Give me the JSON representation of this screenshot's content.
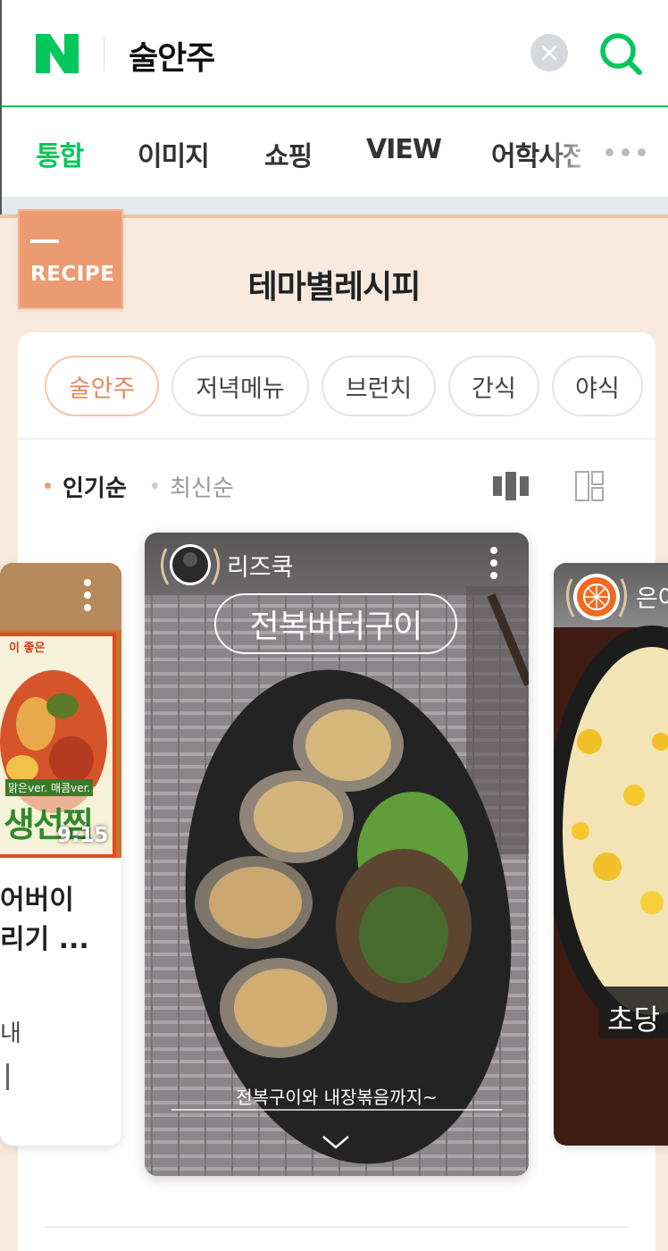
{
  "header": {
    "logo_letter": "N",
    "query": "술안주",
    "clear_icon": "close-icon",
    "search_icon": "search-icon",
    "accent": "#03c75a"
  },
  "tabs": [
    {
      "label": "통합",
      "active": true
    },
    {
      "label": "이미지",
      "active": false
    },
    {
      "label": "쇼핑",
      "active": false
    },
    {
      "label": "VIEW",
      "active": false
    },
    {
      "label": "어학사전",
      "active": false
    }
  ],
  "recipe": {
    "badge": "RECIPE",
    "title": "테마별레시피",
    "badge_color": "#ec9a71",
    "chips": [
      {
        "label": "술안주",
        "active": true
      },
      {
        "label": "저녁메뉴",
        "active": false
      },
      {
        "label": "브런치",
        "active": false
      },
      {
        "label": "간식",
        "active": false
      },
      {
        "label": "야식",
        "active": false
      }
    ],
    "sort": {
      "popular": "인기순",
      "latest": "최신순",
      "active": "popular"
    },
    "view_icons": [
      "column-view-icon",
      "grid-view-icon"
    ]
  },
  "cards": {
    "left": {
      "overlay_top": "이 좋은",
      "overlay_tag": "맑은ver. 매콤ver.",
      "overlay_big": "생선찜",
      "duration": "9:15",
      "title_line1": "어버이",
      "title_line2": "리기 ...",
      "desc_line1": "내",
      "desc_line2": ""
    },
    "main": {
      "author": "리즈쿡",
      "title_overlay": "전복버터구이",
      "caption": "전복구이와 내장볶음까지~"
    },
    "right": {
      "author": "은아",
      "overlay_title": "초당"
    }
  }
}
